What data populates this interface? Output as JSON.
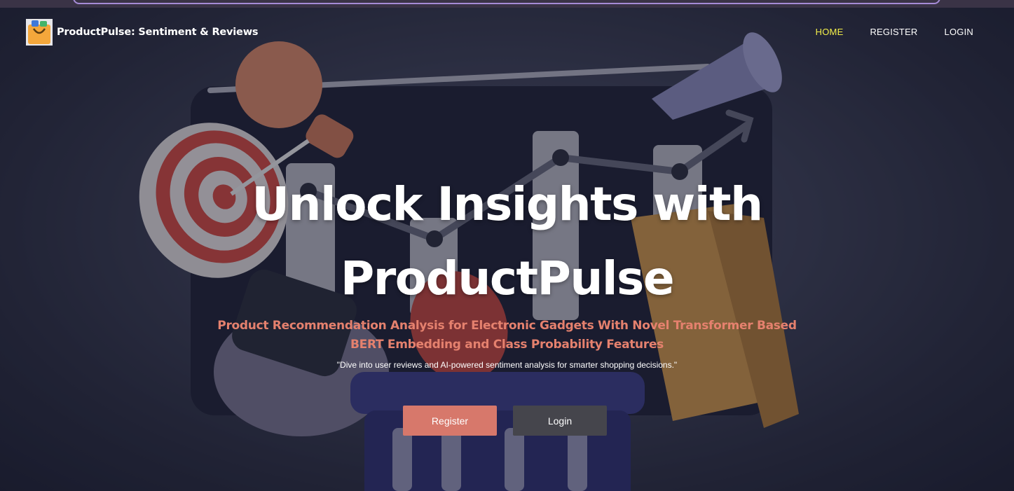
{
  "brand": {
    "name": "ProductPulse: Sentiment & Reviews",
    "logo_icon": "shopping-bag-logo-icon"
  },
  "nav": {
    "items": [
      {
        "label": "HOME",
        "active": true
      },
      {
        "label": "REGISTER",
        "active": false
      },
      {
        "label": "LOGIN",
        "active": false
      }
    ],
    "active_color": "#f4f04a"
  },
  "hero": {
    "headline_line1": "Unlock Insights with",
    "headline_line2": "ProductPulse",
    "subtitle_line1": "Product Recommendation Analysis for Electronic Gadgets With Novel Transformer Based",
    "subtitle_line2": "BERT Embedding and Class Probability Features",
    "tagline": "\"Dive into user reviews and AI-powered sentiment analysis for smarter shopping decisions.\"",
    "register_button": "Register",
    "login_button": "Login"
  },
  "colors": {
    "accent": "#e5816e",
    "register_button": "#d7786b",
    "login_button": "#45454c",
    "top_strip_border": "#a58bd6"
  }
}
